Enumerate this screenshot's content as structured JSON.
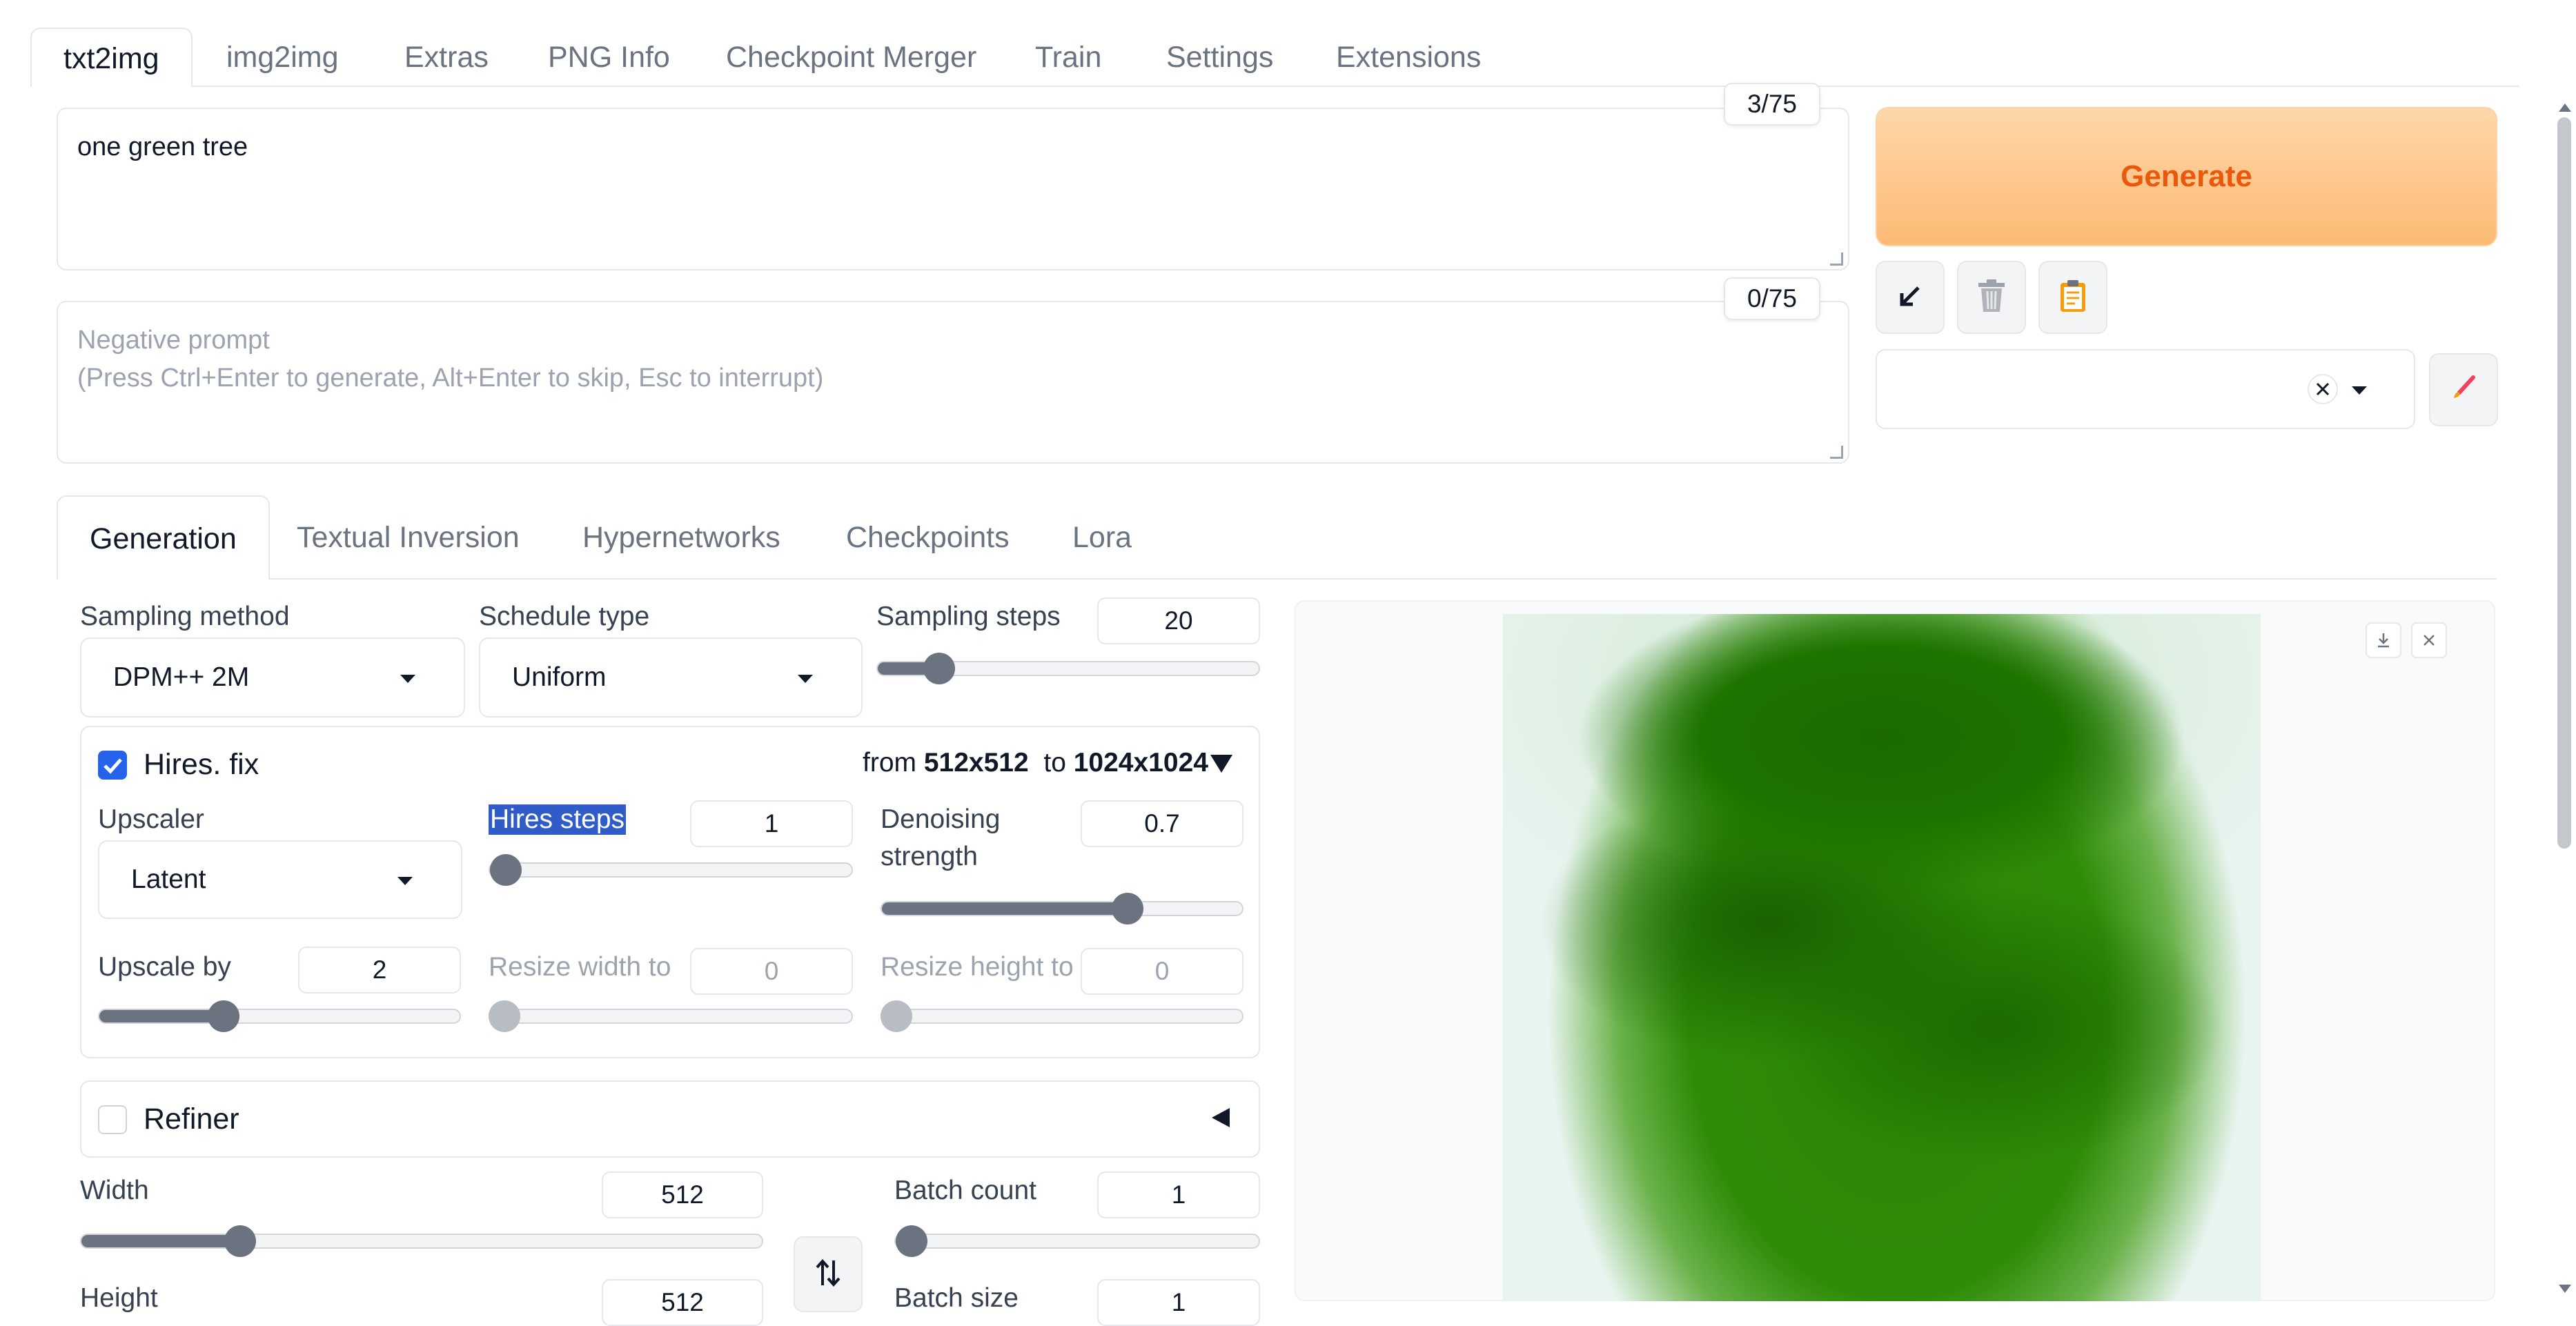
{
  "top_tabs": [
    "txt2img",
    "img2img",
    "Extras",
    "PNG Info",
    "Checkpoint Merger",
    "Train",
    "Settings",
    "Extensions"
  ],
  "prompt": {
    "value": "one green tree",
    "counter": "3/75"
  },
  "negative_prompt": {
    "placeholder_line1": "Negative prompt",
    "placeholder_line2": "(Press Ctrl+Enter to generate, Alt+Enter to skip, Esc to interrupt)",
    "counter": "0/75"
  },
  "generate_label": "Generate",
  "tool_icons": [
    "arrow-down-left-icon",
    "trash-icon",
    "clipboard-icon"
  ],
  "style_select": {
    "clear_icon": "close-icon",
    "caret_icon": "chevron-down-icon"
  },
  "sub_tabs": [
    "Generation",
    "Textual Inversion",
    "Hypernetworks",
    "Checkpoints",
    "Lora"
  ],
  "sampling": {
    "method_label": "Sampling method",
    "method_value": "DPM++ 2M",
    "schedule_label": "Schedule type",
    "schedule_value": "Uniform",
    "steps_label": "Sampling steps",
    "steps_value": "20",
    "steps_fraction": 0.13
  },
  "hires": {
    "label": "Hires. fix",
    "checked": true,
    "summary_from": "from",
    "summary_from_value": "512x512",
    "summary_to": "to",
    "summary_to_value": "1024x1024",
    "upscaler_label": "Upscaler",
    "upscaler_value": "Latent",
    "steps_label": "Hires steps",
    "steps_value": "1",
    "steps_fraction": 0.0,
    "denoise_label_line1": "Denoising",
    "denoise_label_line2": "strength",
    "denoise_value": "0.7",
    "denoise_fraction": 0.7,
    "upscale_by_label": "Upscale by",
    "upscale_by_value": "2",
    "upscale_by_fraction": 0.33,
    "resize_w_label": "Resize width to",
    "resize_w_value": "0",
    "resize_h_label": "Resize height to",
    "resize_h_value": "0"
  },
  "refiner": {
    "label": "Refiner",
    "checked": false
  },
  "width": {
    "label": "Width",
    "value": "512",
    "fraction": 0.22
  },
  "height": {
    "label": "Height",
    "value": "512"
  },
  "batch_count": {
    "label": "Batch count",
    "value": "1",
    "fraction": 0.0
  },
  "batch_size": {
    "label": "Batch size",
    "value": "1"
  },
  "swap_icon": "swap-vertical-icon",
  "image_icons": [
    "download-icon",
    "close-icon"
  ],
  "colors": {
    "accent": "#ea580c",
    "checkbox": "#2563eb",
    "generate_gradient_top": "#fed7aa",
    "generate_gradient_bottom": "#fdba74"
  }
}
